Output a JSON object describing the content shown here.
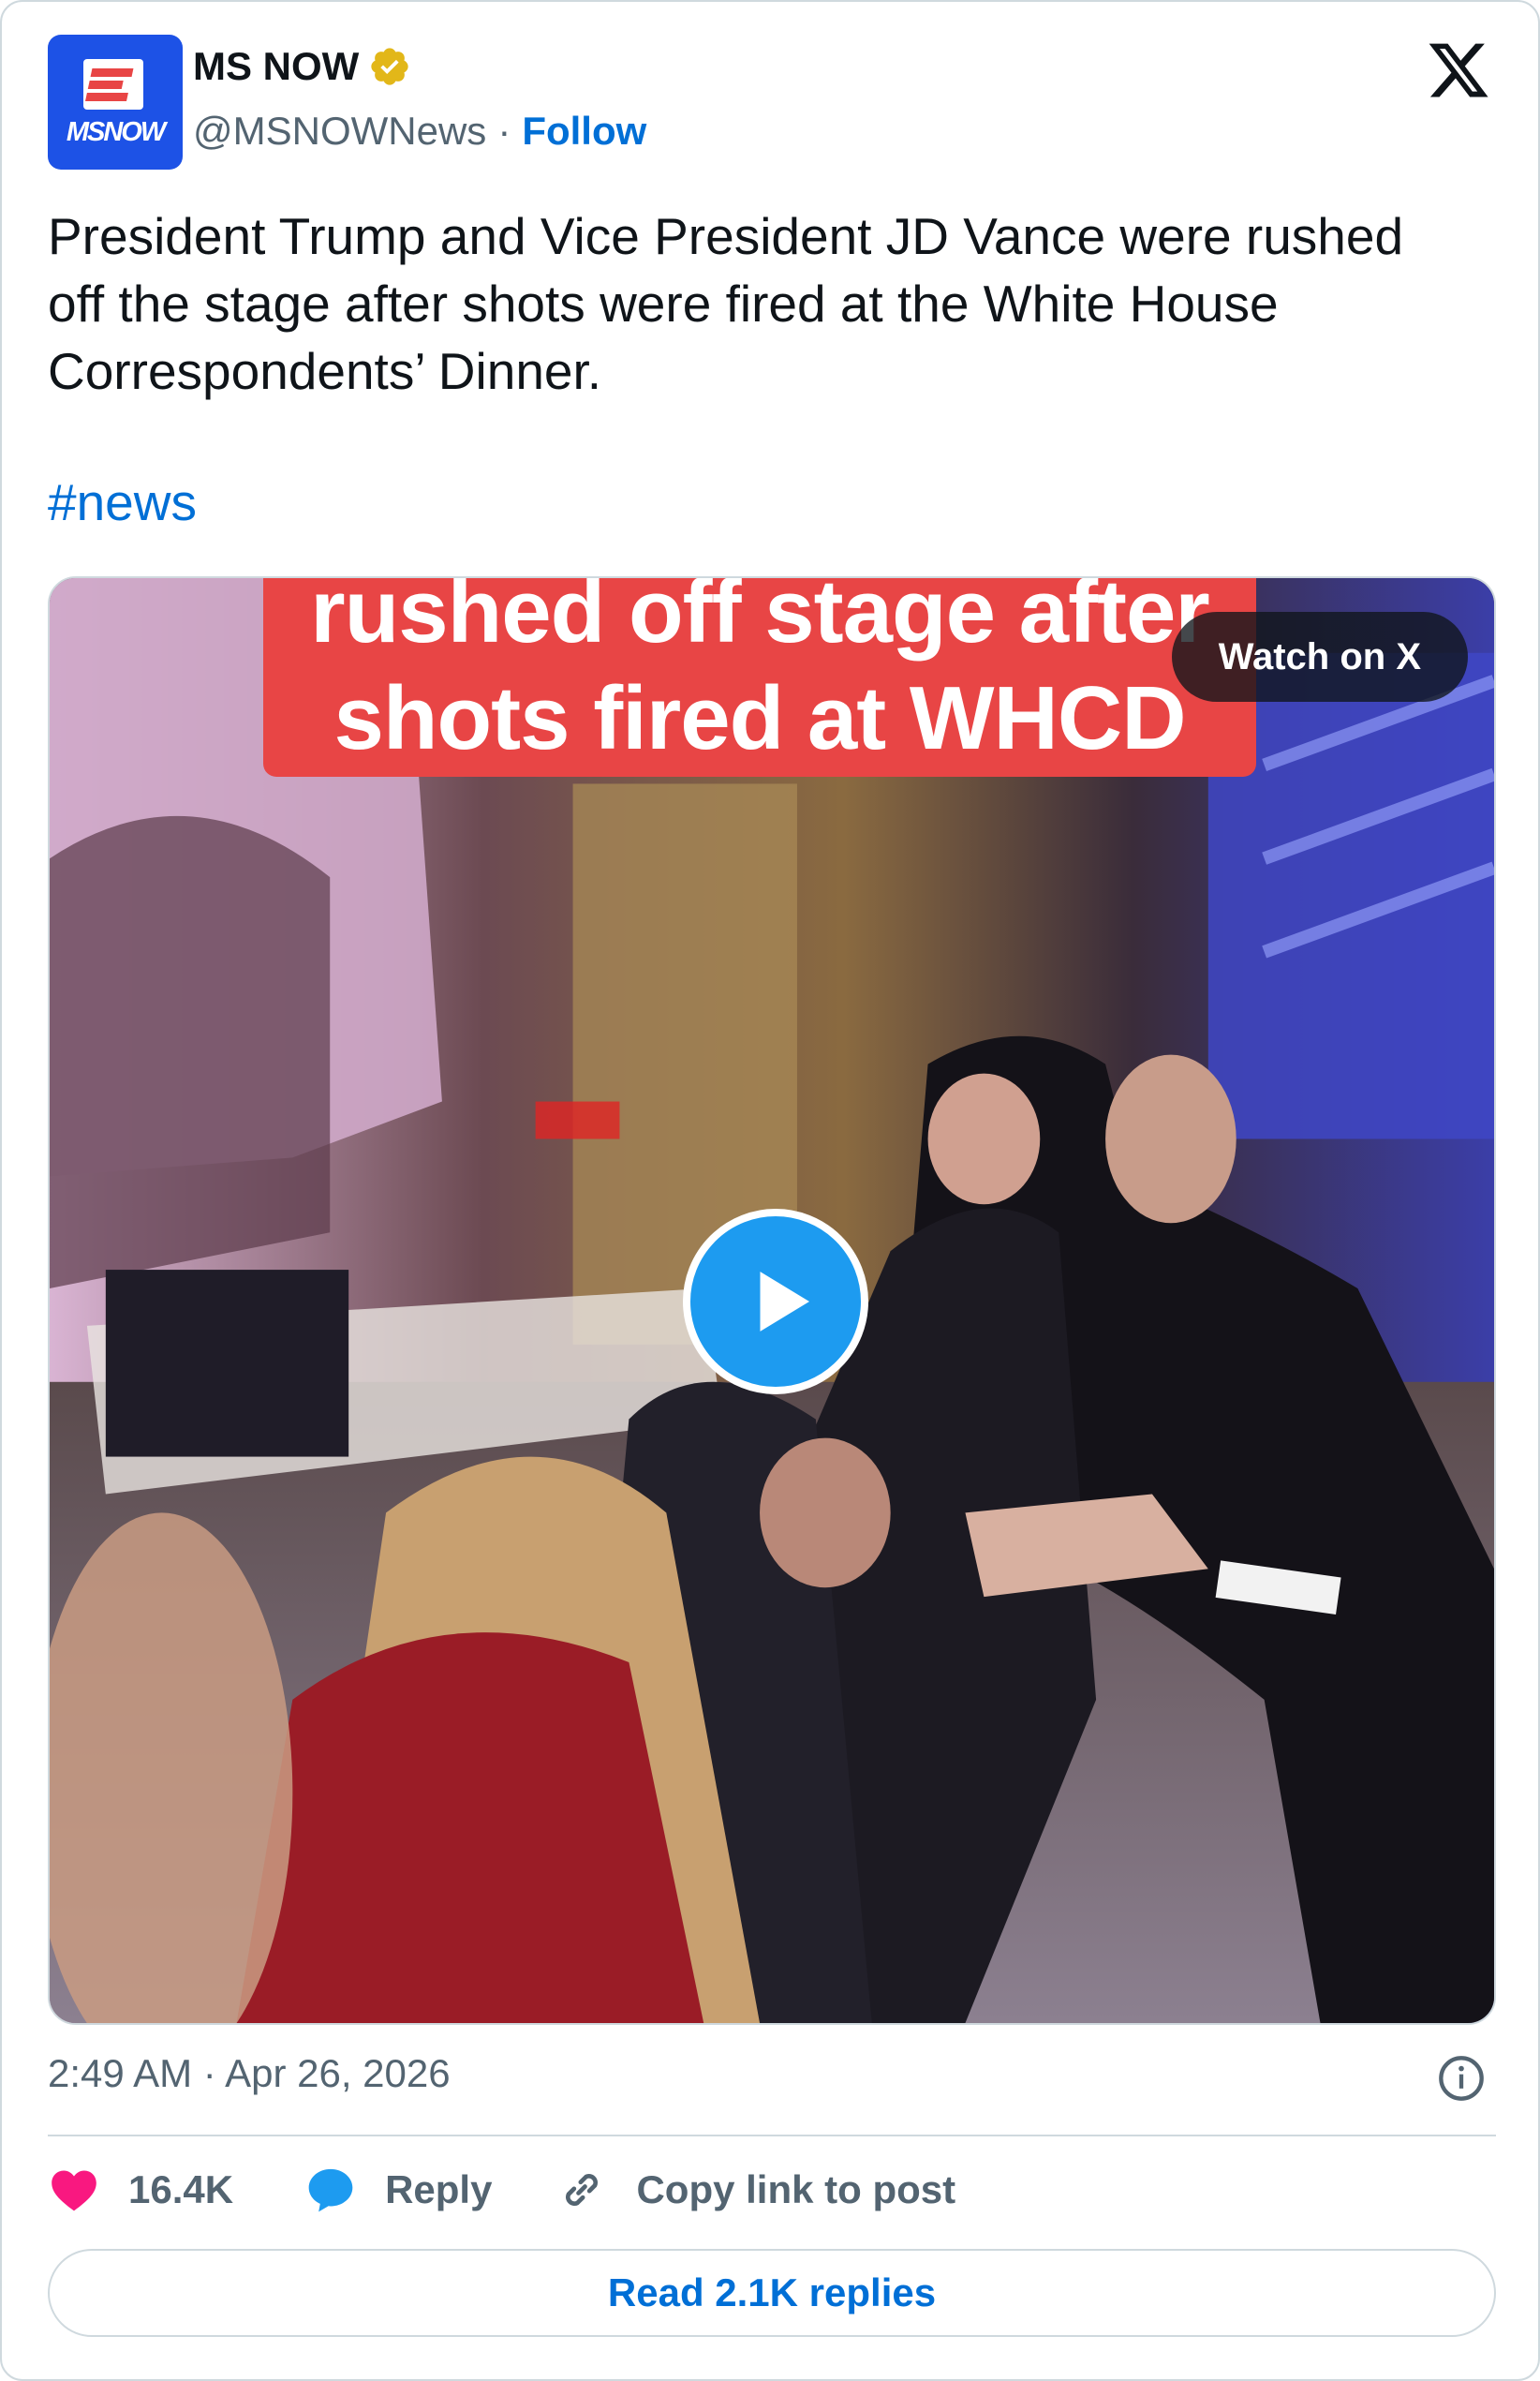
{
  "author": {
    "display_name": "MS NOW",
    "handle": "@MSNOWNews",
    "separator": "·",
    "follow_label": "Follow",
    "avatar_text": "MSNOW",
    "avatar_color": "#1d52e6",
    "verified_color": "#e2b719"
  },
  "tweet": {
    "text": "President Trump and Vice President JD Vance were rushed off the stage after shots were fired at the White House Correspondents’ Dinner.",
    "hashtag": "#news"
  },
  "media": {
    "caption_line1": "rushed off stage after",
    "caption_line2": "shots fired at WHCD",
    "caption_color": "#e84545",
    "watch_label": "Watch on X",
    "play_icon": "play-icon"
  },
  "meta": {
    "timestamp": "2:49 AM · Apr 26, 2026"
  },
  "actions": {
    "like_count": "16.4K",
    "reply_label": "Reply",
    "copy_label": "Copy link to post",
    "read_replies_label": "Read 2.1K replies",
    "like_color": "#f91880",
    "reply_color": "#1d9bf0",
    "link_color": "#006fd6"
  }
}
